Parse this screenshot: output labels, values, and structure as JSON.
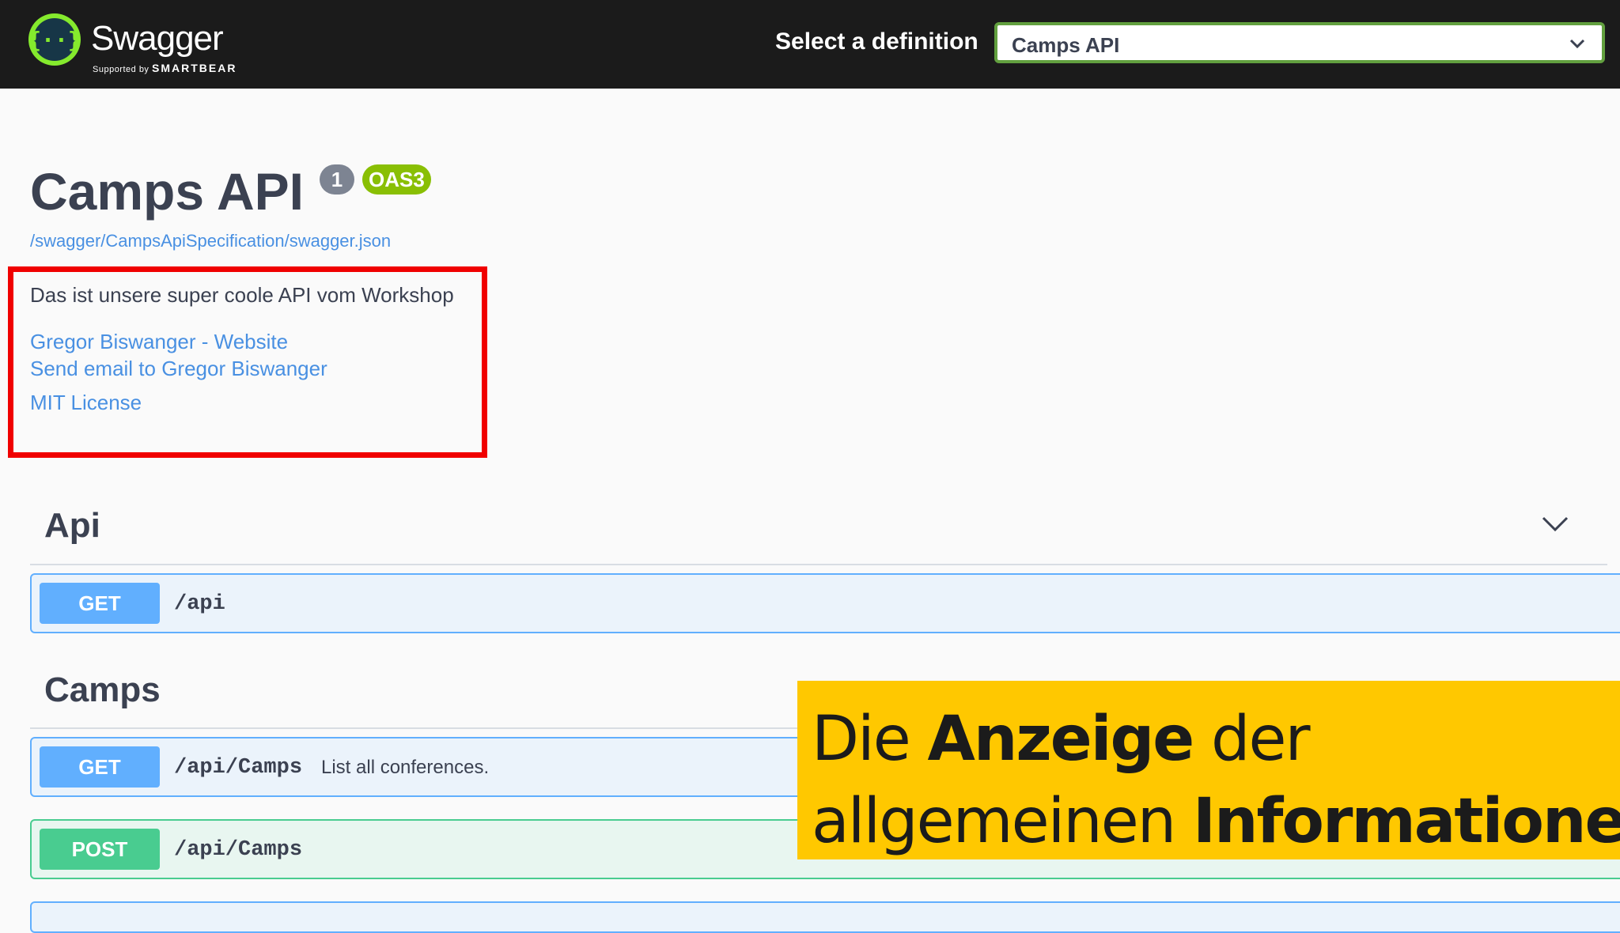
{
  "header": {
    "brand": "Swagger",
    "brand_sub_prefix": "Supported by",
    "brand_sub_company": "SMARTBEAR",
    "select_label": "Select a definition",
    "selected_definition": "Camps API",
    "logo_icon": "swagger-logo-icon",
    "accent_color": "#62a03f"
  },
  "info": {
    "title": "Camps API",
    "version": "1",
    "oas_badge": "OAS3",
    "spec_url": "/swagger/CampsApiSpecification/swagger.json",
    "description": "Das ist unsere super coole API vom Workshop",
    "links": {
      "website": "Gregor Biswanger - Website",
      "email": "Send email to Gregor Biswanger",
      "license": "MIT License"
    },
    "highlight_color": "#f00000"
  },
  "tags": [
    {
      "name": "Api",
      "operations": [
        {
          "method": "GET",
          "path": "/api",
          "summary": ""
        }
      ]
    },
    {
      "name": "Camps",
      "operations": [
        {
          "method": "GET",
          "path": "/api/Camps",
          "summary": "List all conferences."
        },
        {
          "method": "POST",
          "path": "/api/Camps",
          "summary": ""
        }
      ]
    }
  ],
  "method_colors": {
    "GET": "#61affe",
    "POST": "#49cc90"
  },
  "caption": {
    "line1_a": "Die ",
    "line1_b": "Anzeige",
    "line1_c": " der",
    "line2_a": "allgemeinen ",
    "line2_b": "Informationen",
    "background": "#ffc800"
  }
}
